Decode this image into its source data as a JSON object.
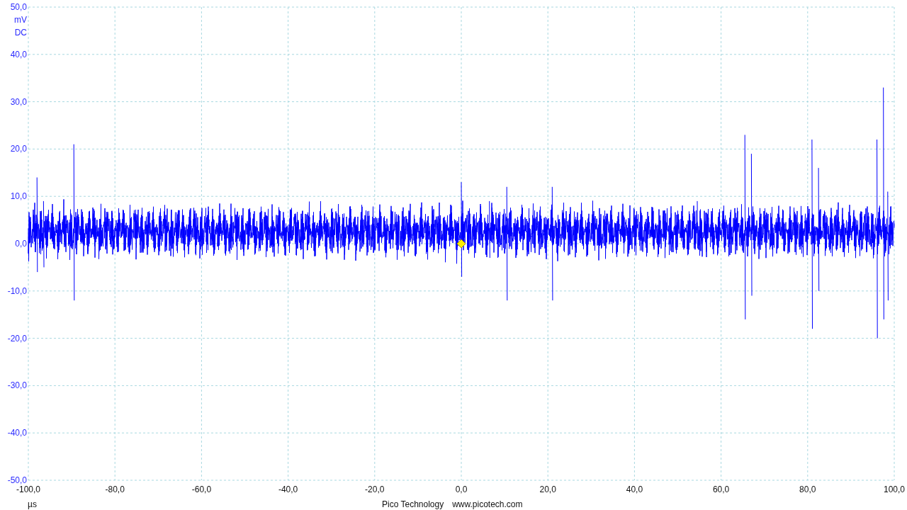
{
  "y_axis": {
    "labels": [
      "50,0",
      "40,0",
      "30,0",
      "20,0",
      "10,0",
      "0,0",
      "-10,0",
      "-20,0",
      "-30,0",
      "-40,0",
      "-50,0"
    ],
    "unit": "mV",
    "coupling": "DC"
  },
  "x_axis": {
    "labels": [
      "-100,0",
      "-80,0",
      "-60,0",
      "-40,0",
      "-20,0",
      "0,0",
      "20,0",
      "40,0",
      "60,0",
      "80,0",
      "100,0"
    ],
    "unit": "µs"
  },
  "footer": {
    "company": "Pico Technology",
    "website": "www.picotech.com"
  }
}
